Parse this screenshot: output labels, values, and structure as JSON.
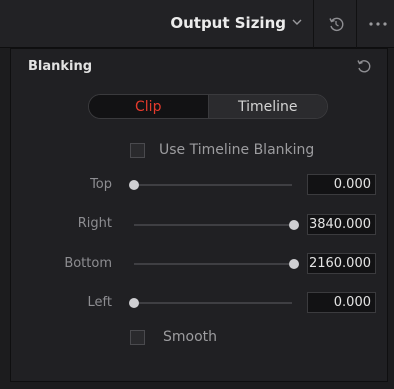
{
  "header": {
    "title": "Output Sizing",
    "icons": [
      "chevron-down-icon",
      "reset-icon",
      "more-icon"
    ]
  },
  "blanking": {
    "title": "Blanking",
    "tabs": [
      {
        "label": "Clip",
        "active": true
      },
      {
        "label": "Timeline",
        "active": false
      }
    ],
    "use_timeline_blanking_label": "Use Timeline Blanking",
    "use_timeline_blanking_checked": false,
    "params": [
      {
        "label": "Top",
        "value": "0.000",
        "slider_fraction": 0.0
      },
      {
        "label": "Right",
        "value": "3840.000",
        "slider_fraction": 1.0
      },
      {
        "label": "Bottom",
        "value": "2160.000",
        "slider_fraction": 1.0
      },
      {
        "label": "Left",
        "value": "0.000",
        "slider_fraction": 0.0
      }
    ],
    "smooth_label": "Smooth",
    "smooth_checked": false
  },
  "colors": {
    "accent": "#e33a2c",
    "background": "#1c1c1e",
    "panel": "#202023"
  }
}
